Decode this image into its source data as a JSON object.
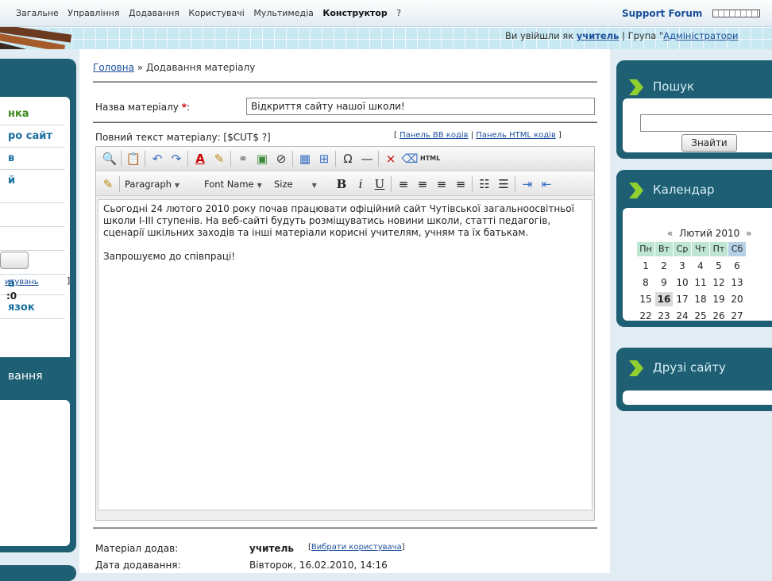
{
  "topnav": {
    "items": [
      "Загальне",
      "Управління",
      "Додавання",
      "Користувачі",
      "Мультимедіа",
      "Конструктор",
      "?"
    ],
    "support": "Support Forum"
  },
  "login": {
    "prefix": "Ви увійшли як",
    "user": "учитель",
    "sep": "| Група \"",
    "group": "Адміністратори"
  },
  "left": {
    "nav": [
      "нка",
      "ро сайт",
      "в",
      "й",
      "",
      "",
      "",
      "а",
      "язок"
    ],
    "panel2_title": "вання",
    "link": "итувань",
    "bracket": "]",
    "value": ":0"
  },
  "breadcrumb": {
    "home": "Головна",
    "sep": "»",
    "current": "Додавання матеріалу"
  },
  "form": {
    "title_label": "Назва матеріалу",
    "required_mark": "*",
    "title_suffix": ":",
    "title_value": "Відкриття сайту нашої школи!",
    "full_label": "Повний текст матеріалу: [$CUT$ ?]",
    "bb_link": "Панель BB кодів",
    "html_link": "Панель HTML кодів",
    "open_bracket": "[",
    "mid_bar": "|",
    "close_bracket": "]"
  },
  "editor": {
    "paragraph": "Paragraph",
    "fontname": "Font Name",
    "size": "Size",
    "content_p1": "Сьогодні 24 лютого 2010 року почав працювати офіційний сайт Чутівської загальноосвітньої школи І-ІІІ ступенів.  На веб-сайті будуть розміщуватись новини школи, статті педагогів, сценарії шкільних заходів та інші матеріали корисні учителям, учням та їх батькам.",
    "content_p2": "Запрошуємо до співпраці!"
  },
  "meta": {
    "author_label": "Матеріал додав:",
    "author_name": "учитель",
    "author_pick": "Вибрати користувача",
    "date_label": "Дата додавання:",
    "date_value": "Вівторок, 16.02.2010, 14:16"
  },
  "right": {
    "search_title": "Пошук",
    "search_btn": "Знайти",
    "calendar_title": "Календар",
    "friends_title": "Друзі сайту"
  },
  "calendar": {
    "prev": "«",
    "month": "Лютий 2010",
    "next": "»",
    "days": [
      "Пн",
      "Вт",
      "Ср",
      "Чт",
      "Пт",
      "Сб"
    ],
    "rows": [
      [
        "1",
        "2",
        "3",
        "4",
        "5",
        "6"
      ],
      [
        "8",
        "9",
        "10",
        "11",
        "12",
        "13"
      ],
      [
        "15",
        "16",
        "17",
        "18",
        "19",
        "20"
      ],
      [
        "22",
        "23",
        "24",
        "25",
        "26",
        "27"
      ]
    ],
    "today": "16"
  },
  "colors": {
    "panel": "#1f5f74",
    "accent_green": "#8fcf2f",
    "link": "#1b4f9c",
    "required": "#cc0000"
  }
}
